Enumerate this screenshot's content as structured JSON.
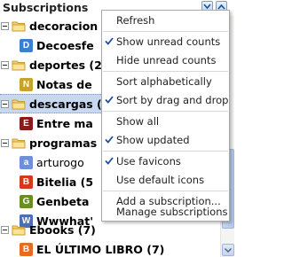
{
  "panel": {
    "title": "Subscriptions"
  },
  "tree": [
    {
      "kind": "folder",
      "label": "decoracion"
    },
    {
      "kind": "feed",
      "label": "Decoesfe",
      "icon": "D",
      "color": "#3a7fd0"
    },
    {
      "kind": "folder",
      "label": "deportes (2)"
    },
    {
      "kind": "feed",
      "label": "Notas de",
      "icon": "N",
      "color": "#c9a227"
    },
    {
      "kind": "folder",
      "label": "descargas (",
      "selected": true
    },
    {
      "kind": "feed",
      "label": "Entre ma",
      "icon": "E",
      "color": "#8b1a1a"
    },
    {
      "kind": "folder",
      "label": "programas"
    },
    {
      "kind": "feed",
      "label": "arturogo",
      "icon": "a",
      "color": "#6f8fd8",
      "plain": true
    },
    {
      "kind": "feed",
      "label": "Bitelia (5",
      "icon": "B",
      "color": "#d23a1f"
    },
    {
      "kind": "feed",
      "label": "Genbeta",
      "icon": "G",
      "color": "#6b8e23"
    },
    {
      "kind": "feed",
      "label": "Wwwhat'",
      "icon": "W",
      "color": "#4a6fb5"
    },
    {
      "kind": "folder",
      "label": "Ebooks (7)"
    },
    {
      "kind": "feed",
      "label": "EL ÚLTIMO LIBRO (7)",
      "icon": "B",
      "color": "#e86b1f"
    }
  ],
  "menu": [
    {
      "label": "Refresh",
      "checked": false
    },
    {
      "label": "Show unread counts",
      "checked": true
    },
    {
      "label": "Hide unread counts",
      "checked": false
    },
    {
      "label": "Sort alphabetically",
      "checked": false
    },
    {
      "label": "Sort by drag and drop",
      "checked": true
    },
    {
      "label": "Show all",
      "checked": false
    },
    {
      "label": "Show updated",
      "checked": true
    },
    {
      "label": "Use favicons",
      "checked": true
    },
    {
      "label": "Use default icons",
      "checked": false
    },
    {
      "label": "Add a subscription...",
      "checked": false
    },
    {
      "label": "Manage subscriptions",
      "checked": false
    }
  ]
}
